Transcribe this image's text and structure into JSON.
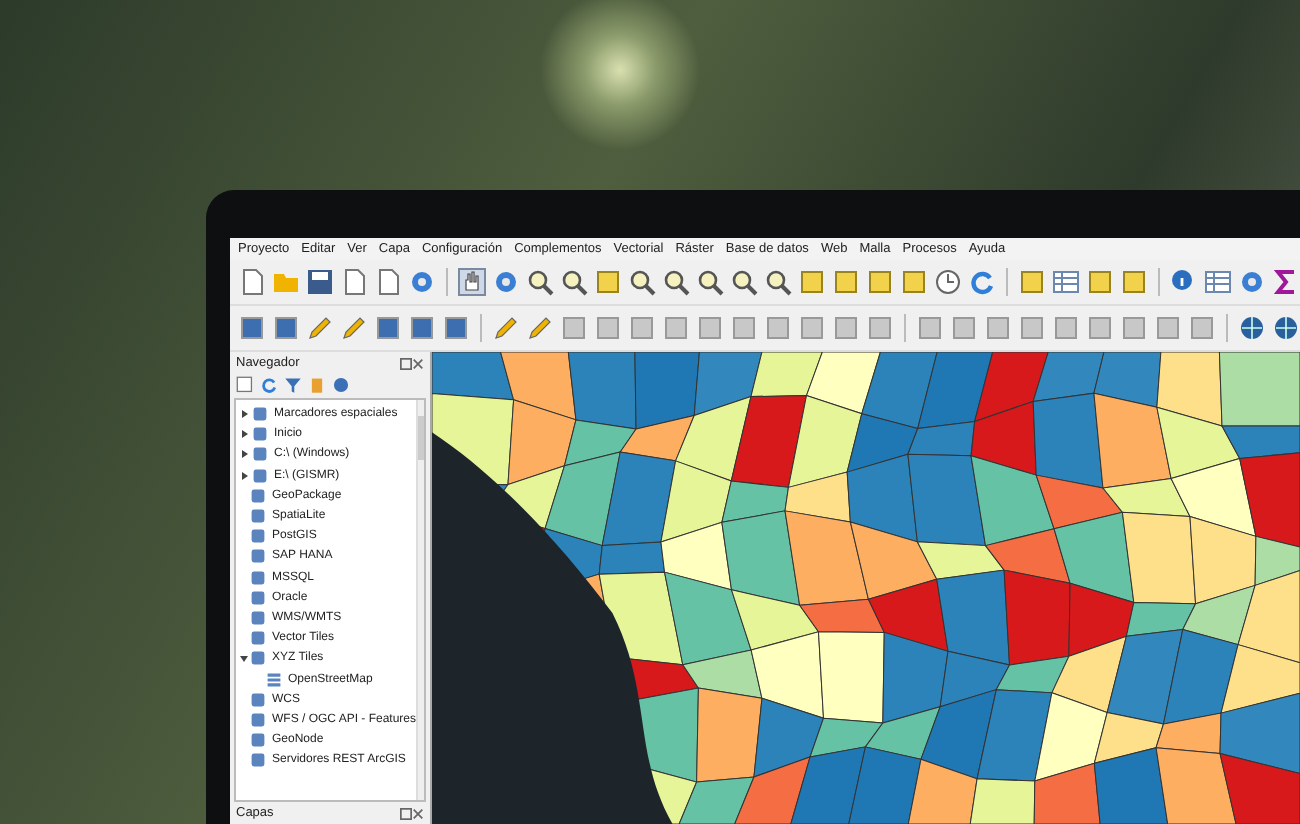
{
  "menu": [
    "Proyecto",
    "Editar",
    "Ver",
    "Capa",
    "Configuración",
    "Complementos",
    "Vectorial",
    "Ráster",
    "Base de datos",
    "Web",
    "Malla",
    "Procesos",
    "Ayuda"
  ],
  "navigator": {
    "title": "Navegador",
    "items": [
      {
        "label": "Marcadores espaciales",
        "expanded": false
      },
      {
        "label": "Inicio",
        "expanded": false
      },
      {
        "label": "C:\\ (Windows)",
        "expanded": false
      },
      {
        "label": "E:\\ (GISMR)",
        "expanded": false
      },
      {
        "label": "GeoPackage"
      },
      {
        "label": "SpatiaLite"
      },
      {
        "label": "PostGIS"
      },
      {
        "label": "SAP HANA"
      },
      {
        "label": "MSSQL"
      },
      {
        "label": "Oracle"
      },
      {
        "label": "WMS/WMTS"
      },
      {
        "label": "Vector Tiles"
      },
      {
        "label": "XYZ Tiles",
        "expanded": true,
        "children": [
          {
            "label": "OpenStreetMap"
          }
        ]
      },
      {
        "label": "WCS"
      },
      {
        "label": "WFS / OGC API - Features"
      },
      {
        "label": "GeoNode"
      },
      {
        "label": "Servidores REST ArcGIS"
      }
    ]
  },
  "layers": {
    "title": "Capas"
  }
}
